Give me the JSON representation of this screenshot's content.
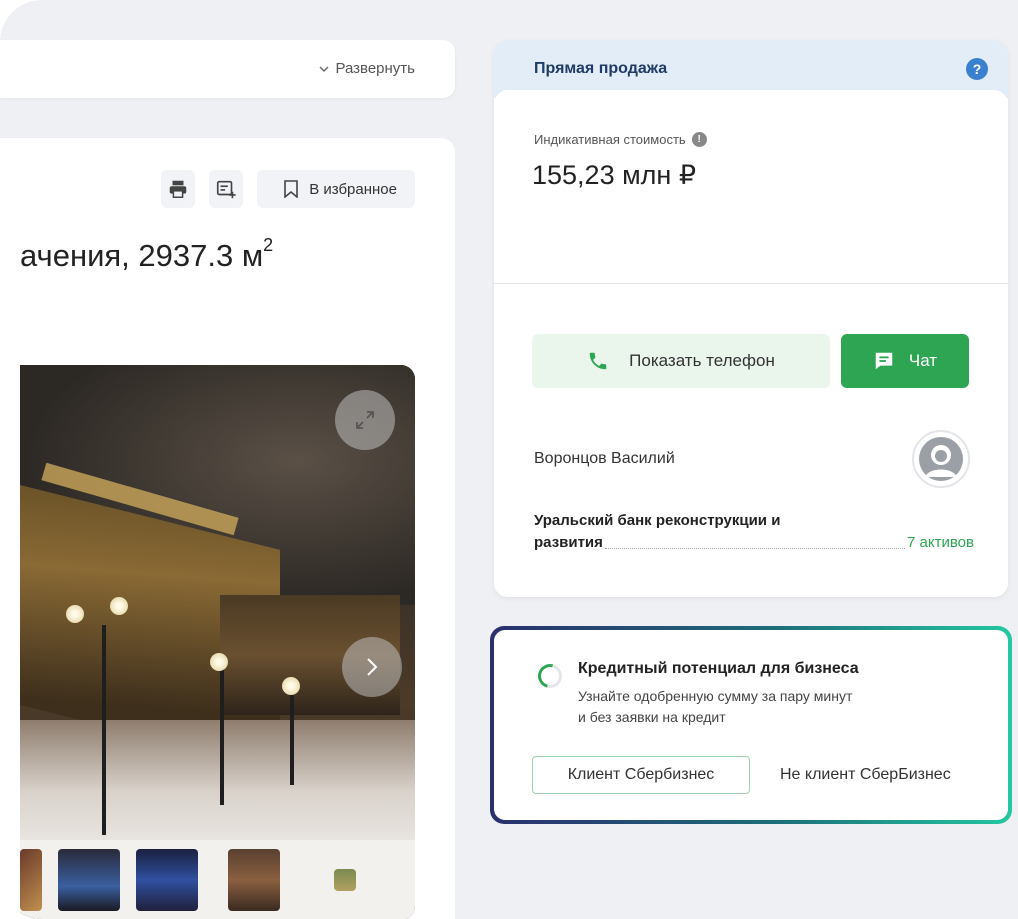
{
  "listing": {
    "expand_label": "Развернуть",
    "favorite_label": "В избранное",
    "title_text": "ачения, 2937.3 м",
    "title_sup": "2",
    "icons": [
      "print-icon",
      "add-note-icon",
      "bookmark-icon",
      "expand-fullscreen-icon",
      "chevron-right-icon"
    ]
  },
  "sale": {
    "header": "Прямая продажа",
    "help_symbol": "?",
    "indicative_label": "Индикативная стоимость",
    "info_symbol": "!",
    "price": "155,23 млн ₽",
    "phone_button": "Показать телефон",
    "chat_button": "Чат",
    "contact_name": "Воронцов Василий",
    "org_line1": "Уральский банк реконструкции и",
    "org_line2": "развития",
    "assets_link": "7 активов"
  },
  "credit": {
    "title": "Кредитный потенциал для бизнеса",
    "subtitle_line1": "Узнайте одобренную сумму за пару минут",
    "subtitle_line2": "и без заявки на кредит",
    "client_button": "Клиент Сбербизнес",
    "nonclient_link": "Не клиент СберБизнес"
  },
  "colors": {
    "accent_green": "#2da553",
    "header_blue": "#e3edf8",
    "help_blue": "#3b7fcf",
    "page_bg": "#eef0f4"
  }
}
